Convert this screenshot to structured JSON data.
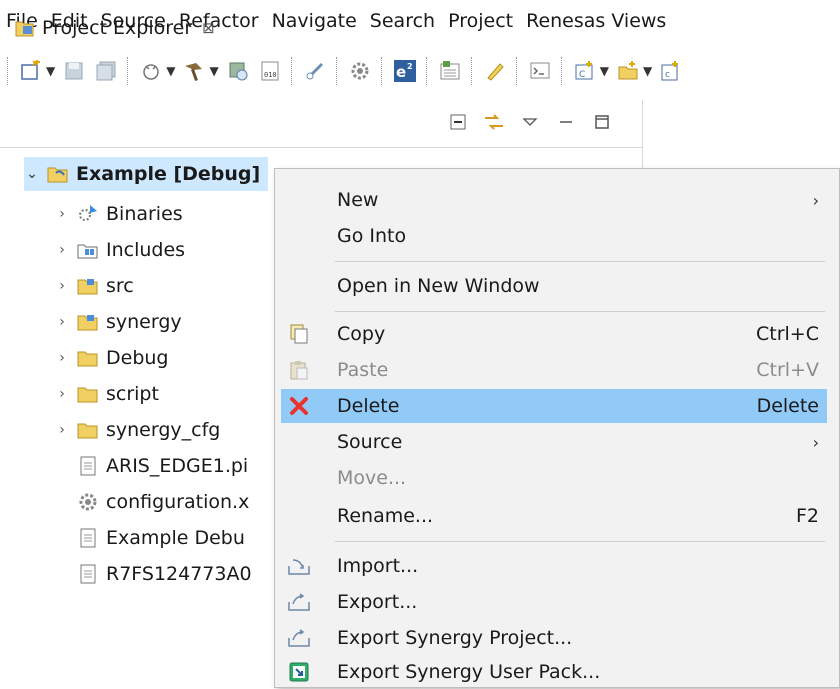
{
  "menubar": [
    "File",
    "Edit",
    "Source",
    "Refactor",
    "Navigate",
    "Search",
    "Project",
    "Renesas Views"
  ],
  "toolbar": {
    "icons": [
      "new-icon",
      "save-icon",
      "save-all-icon",
      "debug-icon",
      "build-icon",
      "target-icon",
      "binary-icon",
      "probe-icon",
      "settings-icon",
      "e2-icon",
      "memory-icon",
      "edit-icon",
      "console-icon",
      "new-project-icon",
      "new-folder-icon",
      "new-c-icon"
    ]
  },
  "explorer": {
    "tab_title": "Project Explorer",
    "close_glyph": "⊠",
    "tree": [
      {
        "label": "Example [Debug]",
        "icon": "project-icon",
        "twisty": "expanded"
      },
      {
        "label": "Binaries",
        "icon": "binaries-icon",
        "twisty": "collapsed"
      },
      {
        "label": "Includes",
        "icon": "includes-icon",
        "twisty": "collapsed"
      },
      {
        "label": "src",
        "icon": "source-folder-icon",
        "twisty": "collapsed"
      },
      {
        "label": "synergy",
        "icon": "source-folder-icon",
        "twisty": "collapsed"
      },
      {
        "label": "Debug",
        "icon": "folder-icon",
        "twisty": "collapsed"
      },
      {
        "label": "script",
        "icon": "folder-icon",
        "twisty": "collapsed"
      },
      {
        "label": "synergy_cfg",
        "icon": "folder-icon",
        "twisty": "collapsed"
      },
      {
        "label": "ARIS_EDGE1.pi",
        "icon": "file-icon",
        "twisty": "none"
      },
      {
        "label": "configuration.x",
        "icon": "gear-icon",
        "twisty": "none"
      },
      {
        "label": "Example Debu",
        "icon": "file-icon",
        "twisty": "none"
      },
      {
        "label": "R7FS124773A0",
        "icon": "file-icon",
        "twisty": "none"
      }
    ]
  },
  "context_menu": {
    "items": [
      {
        "label": "New",
        "key": "",
        "submenu": true,
        "disabled": false,
        "icon": ""
      },
      {
        "label": "Go Into",
        "key": "",
        "submenu": false,
        "disabled": false,
        "icon": ""
      },
      {
        "label": "Open in New Window",
        "key": "",
        "submenu": false,
        "disabled": false,
        "icon": ""
      },
      {
        "label": "Copy",
        "key": "Ctrl+C",
        "submenu": false,
        "disabled": false,
        "icon": "copy-icon"
      },
      {
        "label": "Paste",
        "key": "Ctrl+V",
        "submenu": false,
        "disabled": true,
        "icon": "paste-icon"
      },
      {
        "label": "Delete",
        "key": "Delete",
        "submenu": false,
        "disabled": false,
        "icon": "delete-icon",
        "hover": true
      },
      {
        "label": "Source",
        "key": "",
        "submenu": true,
        "disabled": false,
        "icon": ""
      },
      {
        "label": "Move...",
        "key": "",
        "submenu": false,
        "disabled": true,
        "icon": ""
      },
      {
        "label": "Rename...",
        "key": "F2",
        "submenu": false,
        "disabled": false,
        "icon": ""
      },
      {
        "label": "Import...",
        "key": "",
        "submenu": false,
        "disabled": false,
        "icon": "import-icon"
      },
      {
        "label": "Export...",
        "key": "",
        "submenu": false,
        "disabled": false,
        "icon": "export-icon"
      },
      {
        "label": "Export Synergy Project...",
        "key": "",
        "submenu": false,
        "disabled": false,
        "icon": "export-icon"
      },
      {
        "label": "Export Synergy User Pack...",
        "key": "",
        "submenu": false,
        "disabled": false,
        "icon": "export-pack-icon"
      }
    ],
    "submenu_glyph": "›"
  },
  "colors": {
    "selection": "#cde8ff",
    "menu_hover": "#91c9f7",
    "menu_bg": "#f2f2f2",
    "delete_red": "#e8342c"
  }
}
